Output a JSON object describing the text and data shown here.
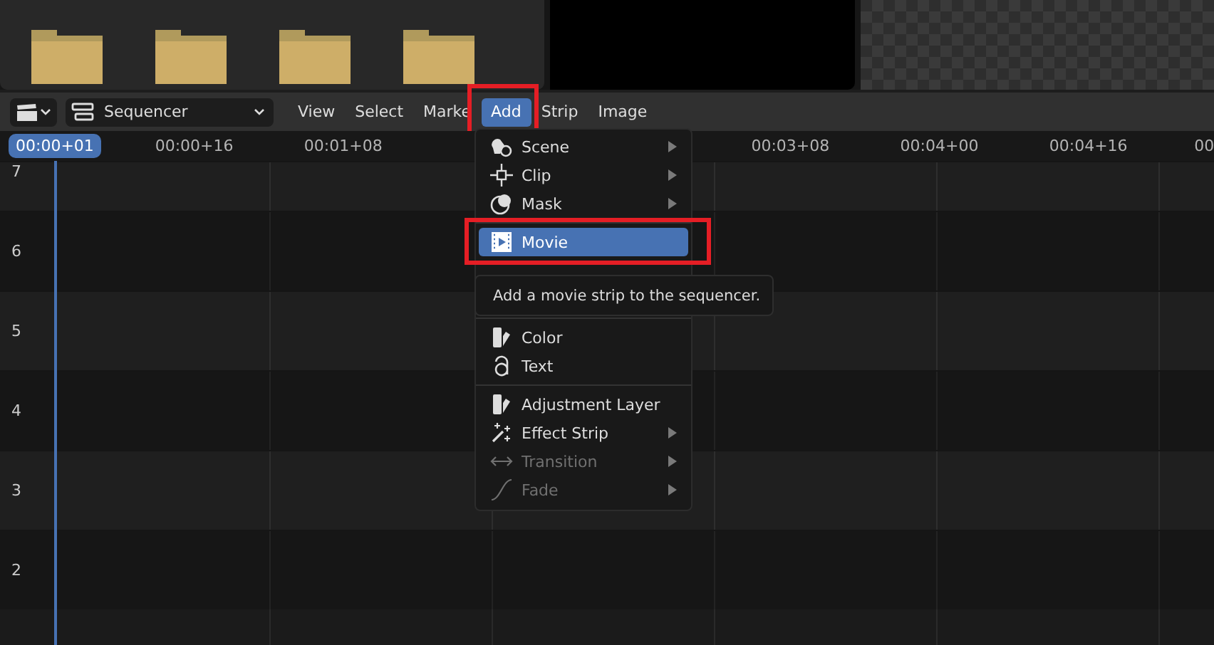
{
  "header": {
    "editor_dropdown": {
      "label": "Sequencer"
    },
    "menus": [
      {
        "label": "View",
        "selected": false,
        "annotated": false
      },
      {
        "label": "Select",
        "selected": false,
        "annotated": false
      },
      {
        "label": "Marke",
        "selected": false,
        "annotated": false
      },
      {
        "label": "Add",
        "selected": true,
        "annotated": true
      },
      {
        "label": "Strip",
        "selected": false,
        "annotated": false
      },
      {
        "label": "Image",
        "selected": false,
        "annotated": false
      }
    ]
  },
  "ruler": {
    "current_frame": "00:00+01",
    "labels": [
      {
        "kind": "tick",
        "text": "00:00+16"
      },
      {
        "kind": "tick",
        "text": "00:01+08"
      },
      {
        "kind": "blank"
      },
      {
        "kind": "blank"
      },
      {
        "kind": "tick",
        "text": "00:03+08"
      },
      {
        "kind": "tick",
        "text": "00:04+00"
      },
      {
        "kind": "tick",
        "text": "00:04+16"
      },
      {
        "kind": "tick",
        "text": "00"
      }
    ]
  },
  "channels": [
    "7",
    "6",
    "5",
    "4",
    "3",
    "2"
  ],
  "add_menu": {
    "items": [
      {
        "kind": "item",
        "label": "Scene",
        "submenu": true,
        "disabled": false,
        "selected": false,
        "annotated": false
      },
      {
        "kind": "item",
        "label": "Clip",
        "submenu": true,
        "disabled": false,
        "selected": false,
        "annotated": false
      },
      {
        "kind": "item",
        "label": "Mask",
        "submenu": true,
        "disabled": false,
        "selected": false,
        "annotated": false
      },
      {
        "kind": "separator"
      },
      {
        "kind": "item",
        "label": "Movie",
        "submenu": false,
        "disabled": false,
        "selected": true,
        "annotated": true
      },
      {
        "kind": "covered"
      },
      {
        "kind": "covered"
      },
      {
        "kind": "separator"
      },
      {
        "kind": "item",
        "label": "Color",
        "submenu": false,
        "disabled": false,
        "selected": false,
        "annotated": false
      },
      {
        "kind": "item",
        "label": "Text",
        "submenu": false,
        "disabled": false,
        "selected": false,
        "annotated": false
      },
      {
        "kind": "separator"
      },
      {
        "kind": "item",
        "label": "Adjustment Layer",
        "submenu": false,
        "disabled": false,
        "selected": false,
        "annotated": false
      },
      {
        "kind": "item",
        "label": "Effect Strip",
        "submenu": true,
        "disabled": false,
        "selected": false,
        "annotated": false
      },
      {
        "kind": "item",
        "label": "Transition",
        "submenu": true,
        "disabled": true,
        "selected": false,
        "annotated": false
      },
      {
        "kind": "item",
        "label": "Fade",
        "submenu": true,
        "disabled": true,
        "selected": false,
        "annotated": false
      }
    ]
  },
  "tooltip": {
    "text": "Add a movie strip to the sequencer."
  }
}
